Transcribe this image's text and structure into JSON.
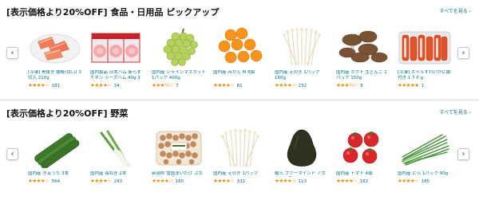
{
  "sections": [
    {
      "title": "[表示価格より20%OFF] 食品・日用品 ピックアップ",
      "see_all": "すべてを見る ›",
      "prev_icon": "‹",
      "next_icon": "›",
      "products": [
        {
          "name": "[冷凍] 骨抜き 銀鮭(甘口) 3切入 210g",
          "stars": "★★★★☆",
          "rating": 4,
          "count": "181",
          "icon": "salmon-fillet-icon"
        },
        {
          "name": "国内製品 日本ハム 新らすチキン シーズハム 40g 3パック",
          "stars": "★★★★☆",
          "rating": 4,
          "count": "34",
          "icon": "ham-pack-icon"
        },
        {
          "name": "国内産 シャインマスカット 1パック 400g",
          "stars": "★★★½☆",
          "rating": 3.5,
          "count": "7",
          "icon": "grapes-icon"
        },
        {
          "name": "国内産 みかん M 8個",
          "stars": "★★★★☆",
          "rating": 4,
          "count": "81",
          "icon": "mandarin-icon"
        },
        {
          "name": "国内産 えのき 1パック 180g",
          "stars": "★★★★☆",
          "rating": 4,
          "count": "232",
          "icon": "enoki-icon"
        },
        {
          "name": "国内産 ホクト 生どんこ 1パック 150g",
          "stars": "★★★½☆",
          "rating": 3.5,
          "count": "8",
          "icon": "shiitake-icon"
        },
        {
          "name": "[冷凍] ボイルずわいがに脚 付き 1 7 0 g",
          "stars": "★★★★★",
          "rating": 5,
          "count": "1",
          "icon": "crab-icon"
        }
      ]
    },
    {
      "title": "[表示価格より20%OFF] 野菜",
      "see_all": "すべてを見る ›",
      "prev_icon": "‹",
      "next_icon": "›",
      "products": [
        {
          "name": "国内産 きゅうり 3本",
          "stars": "★★★★☆",
          "rating": 4,
          "count": "564",
          "icon": "cucumber-icon"
        },
        {
          "name": "国内産 長ねぎ 2本",
          "stars": "★★★★☆",
          "rating": 4,
          "count": "243",
          "icon": "leek-icon"
        },
        {
          "name": "新潟県 雪国まいたけ ぶなしめじ 1パック100g",
          "stars": "★★★★☆",
          "rating": 4,
          "count": "160",
          "icon": "shimeji-icon"
        },
        {
          "name": "国内産 えのき 1パック 180g",
          "stars": "★★★★☆",
          "rating": 4,
          "count": "332",
          "icon": "enoki-icon"
        },
        {
          "name": "輸入 ファーマインド アボカド 1個",
          "stars": "★★★★☆",
          "rating": 4,
          "count": "113",
          "icon": "avocado-icon"
        },
        {
          "name": "国内産 トマト 4個",
          "stars": "★★★★☆",
          "rating": 4,
          "count": "182",
          "icon": "tomato-icon"
        },
        {
          "name": "国内産 にら 1パック 90g",
          "stars": "★★★★☆",
          "rating": 4,
          "count": "185",
          "icon": "chives-icon"
        }
      ]
    }
  ]
}
